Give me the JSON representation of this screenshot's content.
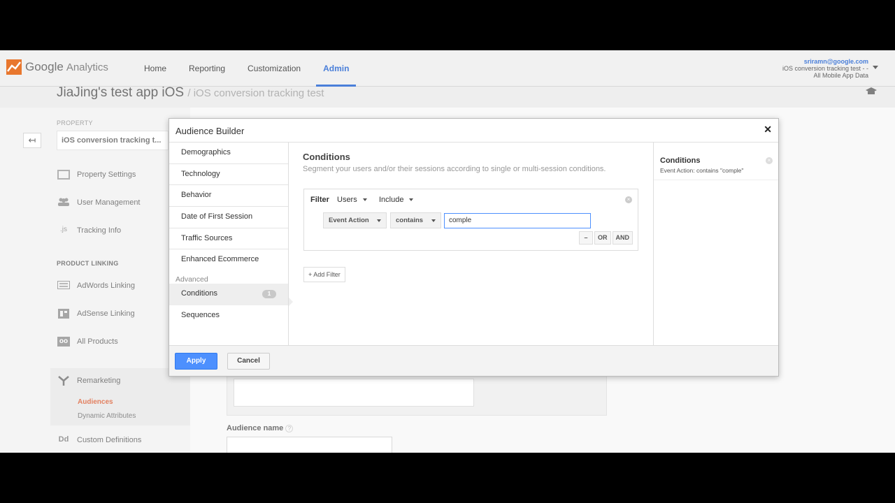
{
  "header": {
    "logo_google": "Google",
    "logo_analytics": "Analytics",
    "nav": [
      {
        "label": "Home"
      },
      {
        "label": "Reporting"
      },
      {
        "label": "Customization"
      },
      {
        "label": "Admin"
      }
    ],
    "account": {
      "email": "sriramn@google.com",
      "property": "iOS conversion tracking test - -",
      "view": "All Mobile App Data"
    }
  },
  "page": {
    "title": "JiaJing's test app iOS",
    "subtitle": "/ iOS conversion tracking test"
  },
  "admin": {
    "back": "↤",
    "property_label": "PROPERTY",
    "property_value": "iOS conversion tracking t...",
    "items": [
      {
        "label": "Property Settings"
      },
      {
        "label": "User Management"
      },
      {
        "label": "Tracking Info",
        "icon_text": ".js"
      }
    ],
    "linking_label": "PRODUCT LINKING",
    "linking_items": [
      {
        "label": "AdWords Linking"
      },
      {
        "label": "AdSense Linking"
      },
      {
        "label": "All Products",
        "icon_text": "oo"
      }
    ],
    "remarketing": "Remarketing",
    "remarketing_sub": [
      "Audiences",
      "Dynamic Attributes"
    ],
    "custom": "Custom Definitions",
    "custom_icon_text": "Dd"
  },
  "background": {
    "audience_name_label": "Audience name",
    "help": "?"
  },
  "modal": {
    "title": "Audience Builder",
    "close": "✕",
    "nav": [
      "Demographics",
      "Technology",
      "Behavior",
      "Date of First Session",
      "Traffic Sources",
      "Enhanced Ecommerce"
    ],
    "advanced_label": "Advanced",
    "conditions": "Conditions",
    "conditions_badge": "1",
    "sequences": "Sequences",
    "content": {
      "title": "Conditions",
      "subtitle": "Segment your users and/or their sessions according to single or multi-session conditions.",
      "filter_label": "Filter",
      "scope": "Users",
      "mode": "Include",
      "dimension": "Event Action",
      "operator": "contains",
      "value": "comple",
      "minus": "–",
      "or": "OR",
      "and": "AND",
      "add_filter": "+ Add Filter",
      "remove": "×"
    },
    "summary": {
      "title": "Conditions",
      "text": "Event Action: contains \"comple\"",
      "remove": "×"
    },
    "apply": "Apply",
    "cancel": "Cancel"
  }
}
